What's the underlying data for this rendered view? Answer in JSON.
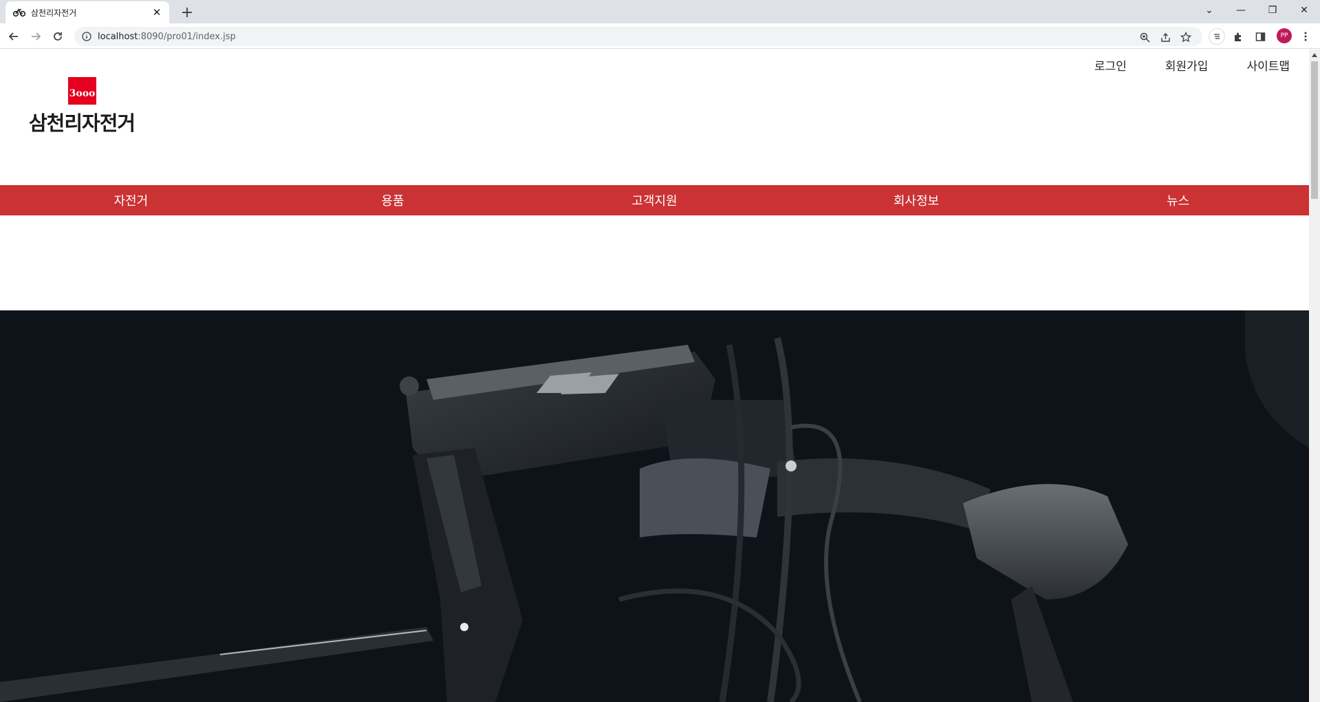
{
  "browser": {
    "tab_title": "삼천리자전거",
    "url_host": "localhost",
    "url_path": ":8090/pro01/index.jsp",
    "profile_initials": "PP"
  },
  "header": {
    "util_links": [
      "로그인",
      "회원가입",
      "사이트맵"
    ],
    "logo_text": "삼천리자전거",
    "logo_mark_text": "3ooo"
  },
  "gnb": {
    "items": [
      "자전거",
      "용품",
      "고객지원",
      "회사정보",
      "뉴스"
    ]
  },
  "colors": {
    "gnb_bg": "#cb3234",
    "logo_red": "#e4001e",
    "hero_bg": "#0f141b"
  }
}
